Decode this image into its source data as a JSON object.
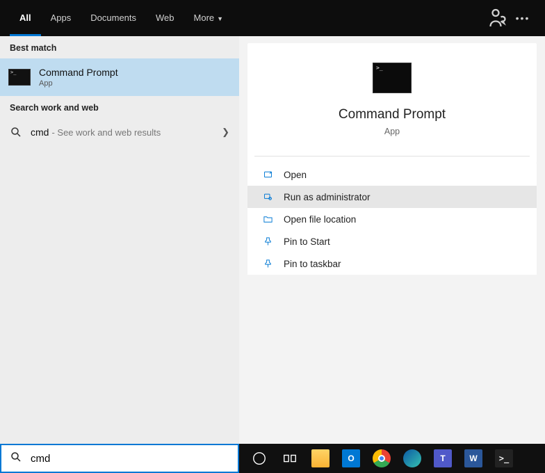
{
  "topbar": {
    "tabs": [
      {
        "label": "All",
        "active": true
      },
      {
        "label": "Apps"
      },
      {
        "label": "Documents"
      },
      {
        "label": "Web"
      },
      {
        "label": "More"
      }
    ]
  },
  "left": {
    "best_match_header": "Best match",
    "result": {
      "title": "Command Prompt",
      "subtitle": "App"
    },
    "search_section_header": "Search work and web",
    "web_query": "cmd",
    "web_hint": "- See work and web results"
  },
  "right": {
    "title": "Command Prompt",
    "subtitle": "App",
    "actions": [
      {
        "label": "Open",
        "icon": "open"
      },
      {
        "label": "Run as administrator",
        "icon": "admin",
        "hover": true
      },
      {
        "label": "Open file location",
        "icon": "folder"
      },
      {
        "label": "Pin to Start",
        "icon": "pin"
      },
      {
        "label": "Pin to taskbar",
        "icon": "pin"
      }
    ]
  },
  "search_value": "cmd",
  "taskbar_icons": [
    "cortana",
    "taskview",
    "explorer",
    "outlook",
    "chrome",
    "edge",
    "teams",
    "word",
    "terminal"
  ]
}
